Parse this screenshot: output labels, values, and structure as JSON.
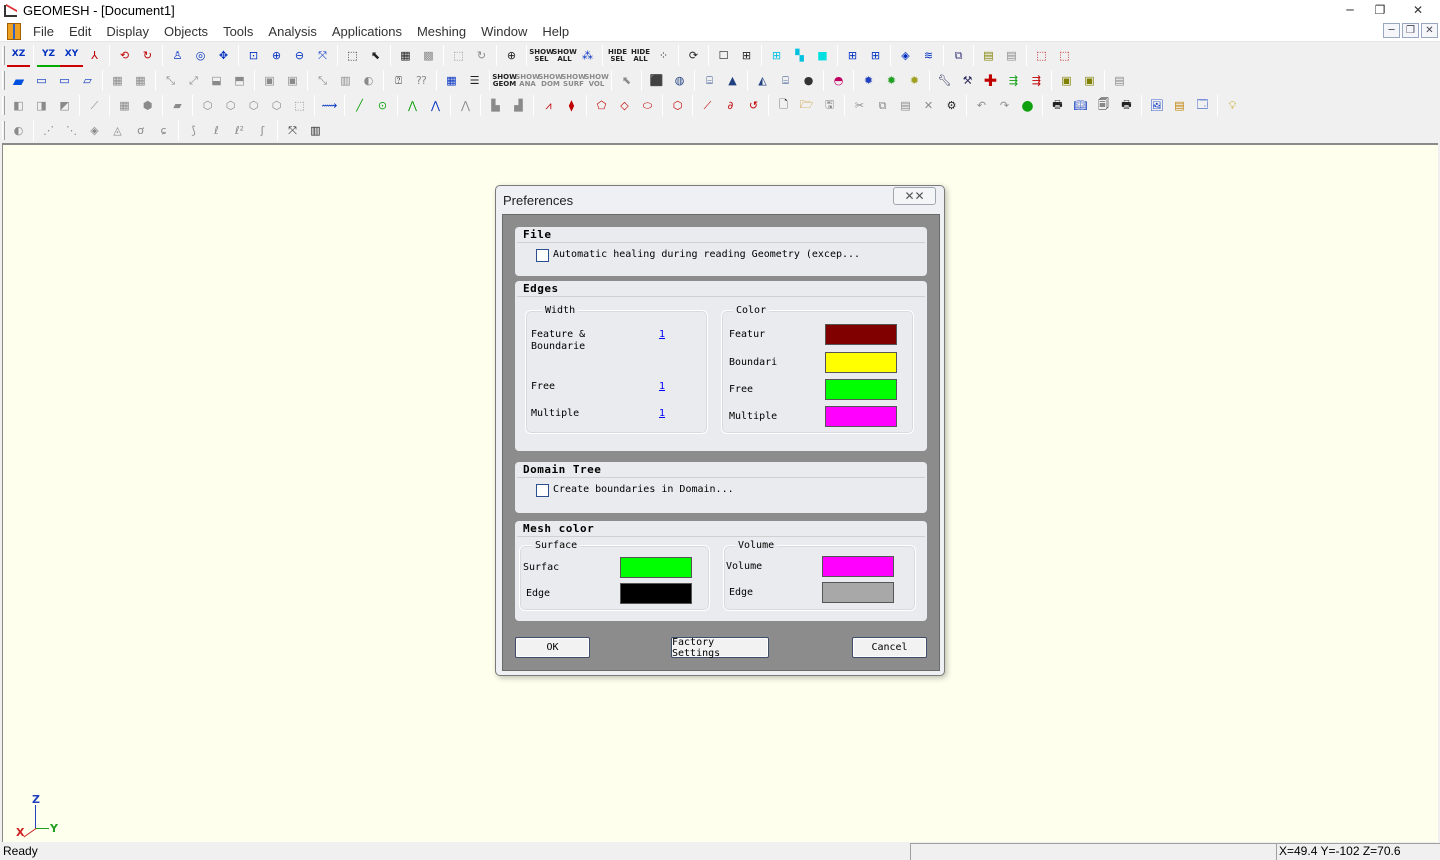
{
  "window": {
    "title": "GEOMESH - [Document1]",
    "min": "─",
    "max": "❐",
    "close": "✕"
  },
  "menu": [
    "File",
    "Edit",
    "Display",
    "Objects",
    "Tools",
    "Analysis",
    "Applications",
    "Meshing",
    "Window",
    "Help"
  ],
  "toolbar_text": {
    "xz": "XZ",
    "yz": "YZ",
    "xy": "XY",
    "show_sel": "SHOW SEL",
    "show_all": "SHOW ALL",
    "hide_sel": "HIDE SEL",
    "hide_all": "HIDE ALL",
    "show_geom": "SHOW GEOM",
    "show_ana": "SHOW ANA",
    "show_dom": "SHOW DOM",
    "show_surf": "SHOW SURF",
    "show_vol": "SHOW VOL"
  },
  "axis": {
    "x": "X",
    "y": "Y",
    "z": "Z"
  },
  "status": {
    "text": "Ready",
    "coords": "X=49.4  Y=-102  Z=70.6"
  },
  "dialog": {
    "title": "Preferences",
    "close": "✕✕",
    "file": {
      "title": "File",
      "auto_heal_label": "Automatic healing during reading Geometry (excep...",
      "auto_heal_checked": false
    },
    "edges": {
      "title": "Edges",
      "width_title": "Width",
      "color_title": "Color",
      "width_rows": [
        {
          "label": "Feature & Boundarie",
          "value": "1"
        },
        {
          "label": "Free",
          "value": "1"
        },
        {
          "label": "Multiple",
          "value": "1"
        }
      ],
      "color_rows": [
        {
          "label": "Featur",
          "color": "#800000"
        },
        {
          "label": "Boundari",
          "color": "#ffff00"
        },
        {
          "label": "Free",
          "color": "#00ff00"
        },
        {
          "label": "Multiple",
          "color": "#ff00ff"
        }
      ]
    },
    "domain_tree": {
      "title": "Domain Tree",
      "create_boundaries_label": "Create boundaries in Domain...",
      "create_boundaries_checked": false
    },
    "mesh_color": {
      "title": "Mesh color",
      "surface_title": "Surface",
      "volume_title": "Volume",
      "surface_rows": [
        {
          "label": "Surfac",
          "color": "#00ff00"
        },
        {
          "label": "Edge",
          "color": "#000000"
        }
      ],
      "volume_rows": [
        {
          "label": "Volume",
          "color": "#ff00ff"
        },
        {
          "label": "Edge",
          "color": "#a8a8a8"
        }
      ]
    },
    "buttons": {
      "ok": "OK",
      "factory": "Factory Settings",
      "cancel": "Cancel"
    }
  }
}
